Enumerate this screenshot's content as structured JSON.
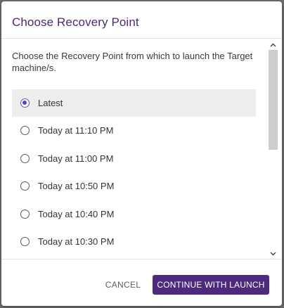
{
  "dialog": {
    "title": "Choose Recovery Point",
    "description": "Choose the Recovery Point from which to launch the Target machine/s.",
    "options": [
      {
        "label": "Latest",
        "selected": true
      },
      {
        "label": "Today at 11:10 PM",
        "selected": false
      },
      {
        "label": "Today at 11:00 PM",
        "selected": false
      },
      {
        "label": "Today at 10:50 PM",
        "selected": false
      },
      {
        "label": "Today at 10:40 PM",
        "selected": false
      },
      {
        "label": "Today at 10:30 PM",
        "selected": false
      }
    ],
    "cancel_label": "CANCEL",
    "continue_label": "CONTINUE WITH LAUNCH"
  },
  "colors": {
    "title": "#4b2a74",
    "primary_button": "#4e2a7e",
    "radio_selected": "#4f47c0",
    "selected_row": "#ededed"
  },
  "icons": {
    "scroll_up": "chevron-up-icon",
    "scroll_down": "chevron-down-icon"
  }
}
